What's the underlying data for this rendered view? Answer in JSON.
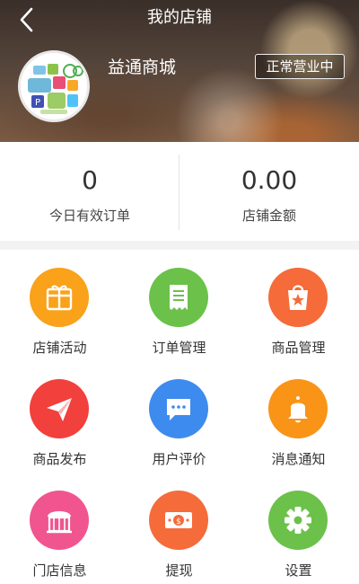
{
  "header": {
    "title": "我的店铺",
    "shop_name": "益通商城",
    "status": "正常营业中"
  },
  "stats": [
    {
      "value": "0",
      "label": "今日有效订单"
    },
    {
      "value": "0.00",
      "label": "店铺金额"
    }
  ],
  "menu": [
    {
      "label": "店铺活动",
      "icon": "gift-box-icon",
      "color": "#f9a21a"
    },
    {
      "label": "订单管理",
      "icon": "receipt-icon",
      "color": "#6cc14a"
    },
    {
      "label": "商品管理",
      "icon": "shopping-bag-icon",
      "color": "#f56b3a"
    },
    {
      "label": "商品发布",
      "icon": "paper-plane-icon",
      "color": "#f2403c"
    },
    {
      "label": "用户评价",
      "icon": "chat-bubble-icon",
      "color": "#3e8bef"
    },
    {
      "label": "消息通知",
      "icon": "bell-icon",
      "color": "#f99417"
    },
    {
      "label": "门店信息",
      "icon": "storefront-icon",
      "color": "#f0558f"
    },
    {
      "label": "提现",
      "icon": "banknote-icon",
      "color": "#f56b3a"
    },
    {
      "label": "设置",
      "icon": "gear-icon",
      "color": "#6cc14a"
    }
  ]
}
